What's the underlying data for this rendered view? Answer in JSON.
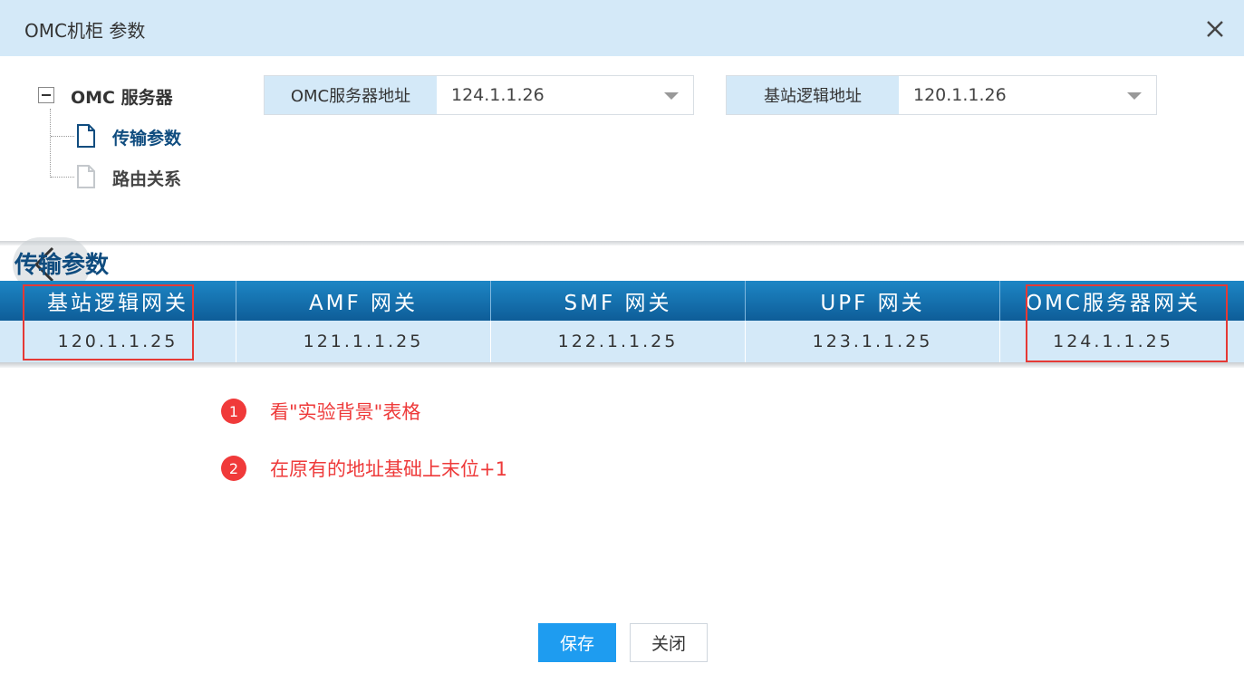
{
  "window": {
    "title": "OMC机柜 参数"
  },
  "tree": {
    "root": {
      "label": "OMC 服务器",
      "expanded": true
    },
    "children": [
      {
        "label": "传输参数",
        "selected": true,
        "icon": "file-icon"
      },
      {
        "label": "路由关系",
        "selected": false,
        "icon": "file-icon"
      }
    ]
  },
  "form": {
    "omc_server_address": {
      "label": "OMC服务器地址",
      "value": "124.1.1.26"
    },
    "base_station_logic_address": {
      "label": "基站逻辑地址",
      "value": "120.1.1.26"
    }
  },
  "section": {
    "title": "传输参数"
  },
  "table": {
    "headers": [
      "基站逻辑网关",
      "AMF 网关",
      "SMF 网关",
      "UPF 网关",
      "OMC服务器网关"
    ],
    "rows": [
      [
        "120.1.1.25",
        "121.1.1.25",
        "122.1.1.25",
        "123.1.1.25",
        "124.1.1.25"
      ]
    ]
  },
  "notes": [
    {
      "number": "1",
      "text": "看\"实验背景\"表格"
    },
    {
      "number": "2",
      "text": "在原有的地址基础上末位+1"
    }
  ],
  "buttons": {
    "save": "保存",
    "close": "关闭"
  },
  "colors": {
    "header_bg": "#d4e9f8",
    "accent_blue": "#1e9cf0",
    "table_header": "#1d86c5",
    "highlight_red": "#e53935",
    "selected_text": "#0f4c7f"
  }
}
